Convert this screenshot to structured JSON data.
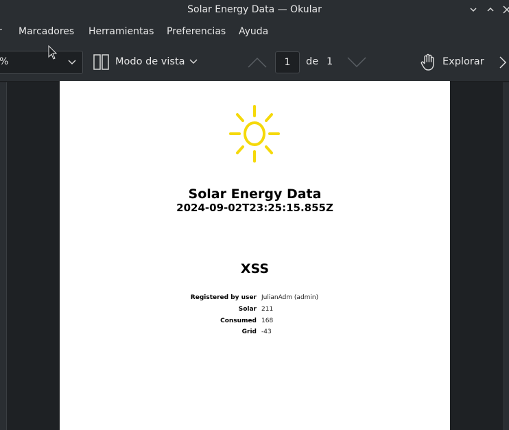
{
  "window": {
    "title": "Solar Energy Data — Okular"
  },
  "menubar": {
    "items": [
      {
        "label": "r"
      },
      {
        "label": "Marcadores"
      },
      {
        "label": "Herramientas"
      },
      {
        "label": "Preferencias"
      },
      {
        "label": "Ayuda"
      }
    ]
  },
  "toolbar": {
    "zoom_value": "%",
    "view_mode_label": "Modo de vista",
    "current_page": "1",
    "page_of_label": "de",
    "total_pages": "1",
    "browse_label": "Explorar"
  },
  "document": {
    "title": "Solar Energy Data",
    "timestamp": "2024-09-02T23:25:15.855Z",
    "heading": "XSS",
    "fields": [
      {
        "key": "Registered by user",
        "value": "JulianAdm (admin)"
      },
      {
        "key": "Solar",
        "value": "211"
      },
      {
        "key": "Consumed",
        "value": "168"
      },
      {
        "key": "Grid",
        "value": "-43"
      }
    ],
    "sun_color": "#f5d90a"
  }
}
